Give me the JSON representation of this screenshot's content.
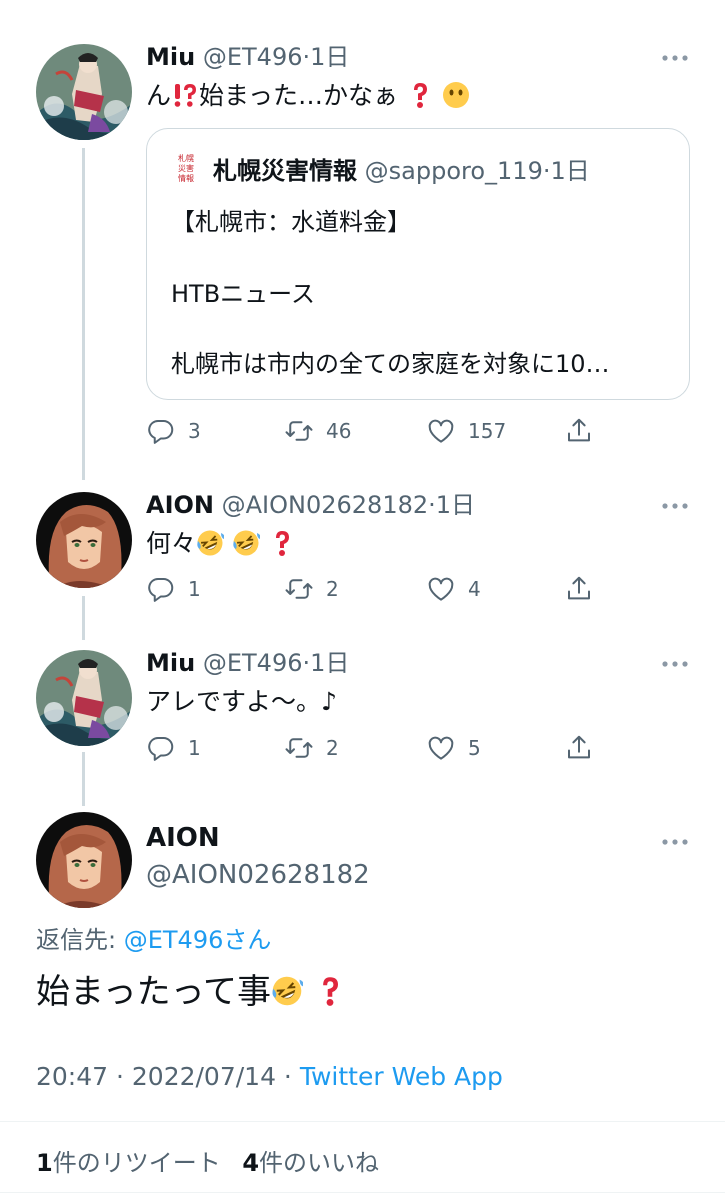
{
  "tweets": [
    {
      "name": "Miu",
      "handle": "@ET496",
      "dot": "·",
      "time": "1日",
      "text_before": "ん",
      "text_middle": "始まった…かなぁ",
      "replies": "3",
      "retweets": "46",
      "likes": "157"
    },
    {
      "name": "AION",
      "handle": "@AION02628182",
      "dot": "·",
      "time": "1日",
      "text": "何々",
      "replies": "1",
      "retweets": "2",
      "likes": "4"
    },
    {
      "name": "Miu",
      "handle": "@ET496",
      "dot": "·",
      "time": "1日",
      "text": "アレですよ〜。♪",
      "replies": "1",
      "retweets": "2",
      "likes": "5"
    }
  ],
  "quote": {
    "logo_text": "札幌災害情報",
    "name": "札幌災害情報",
    "handle": "@sapporo_119",
    "dot": "·",
    "time": "1日",
    "line1": "【札幌市：水道料金】",
    "line2": "HTBニュース",
    "line3": "札幌市は市内の全ての家庭を対象に10…"
  },
  "main": {
    "name": "AION",
    "handle": "@AION02628182",
    "replying_prefix": "返信先: ",
    "replying_to": "@ET496",
    "replying_suffix": "さん",
    "text": "始まったって事",
    "time": "20:47",
    "sep": " · ",
    "date": "2022/07/14",
    "app": "Twitter Web App",
    "retweet_count": "1",
    "retweet_label": "件のリツイート",
    "like_count": "4",
    "like_label": "件のいいね"
  },
  "icons": [
    "reply-icon",
    "retweet-icon",
    "like-icon",
    "share-icon",
    "more-icon",
    "question-icon",
    "rofl-emoji-icon",
    "neutral-face-icon",
    "exclamation-question-icon"
  ],
  "colors": {
    "accent": "#1d9bf0",
    "secondary": "#536471",
    "border": "#cfd9de",
    "question_red": "#e0263d"
  }
}
